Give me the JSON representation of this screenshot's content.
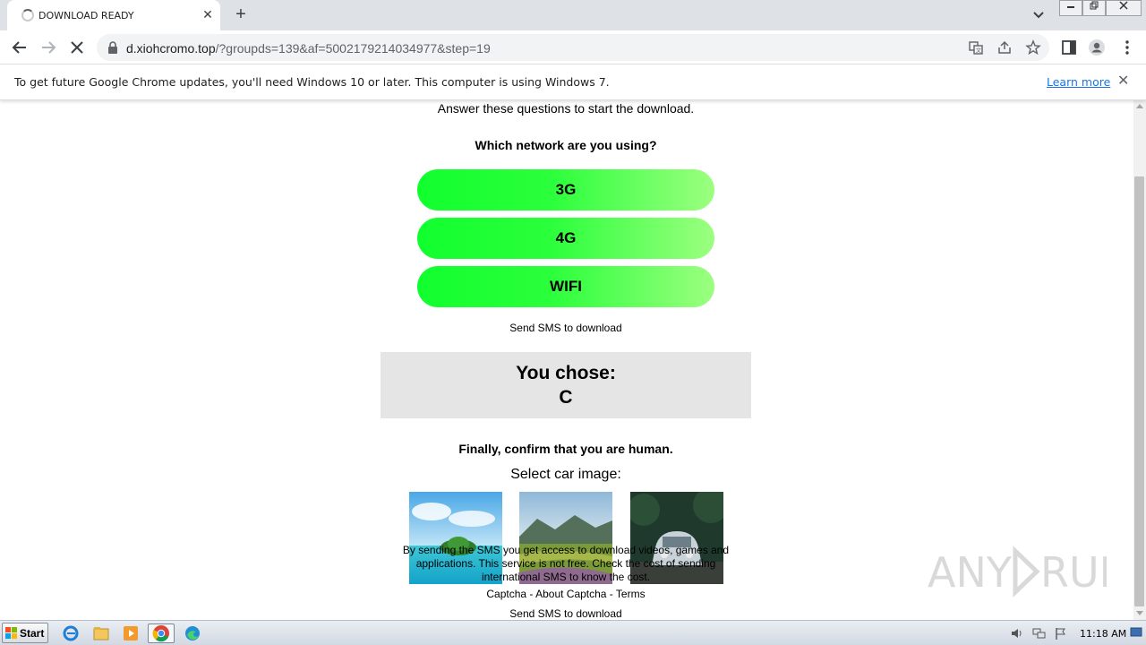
{
  "browser": {
    "tab_title": "DOWNLOAD READY",
    "tab_close": "✕",
    "new_tab": "+",
    "url_host": "d.xiohcromo.top",
    "url_rest": "/?groupds=139&af=5002179214034977&step=19"
  },
  "infobar": {
    "message": "To get future Google Chrome updates, you'll need Windows 10 or later. This computer is using Windows 7.",
    "link": "Learn more",
    "close": "✕"
  },
  "page": {
    "intro": "Answer these questions to start the download.",
    "question": "Which network are you using?",
    "options": [
      "3G",
      "4G",
      "WIFI"
    ],
    "send_sms_top": "Send SMS to download",
    "chose_label": "You chose:",
    "chose_value": "C",
    "confirm": "Finally, confirm that you are human.",
    "select_prompt": "Select car image:",
    "images": [
      "island-image",
      "mountain-field-image",
      "car-image"
    ],
    "disclaimer": "By sending the SMS you get access to download videos, games and applications. This service is not free. Check the cost of sending international SMS to know the cost.",
    "captcha_links": "Captcha - About Captcha - Terms",
    "send_sms_bottom": "Send SMS to download",
    "option_gradient": [
      "#11ff2e",
      "#9cff80"
    ]
  },
  "taskbar": {
    "start_label": "Start",
    "clock": "11:18 AM"
  },
  "watermark": "ANY RUN"
}
